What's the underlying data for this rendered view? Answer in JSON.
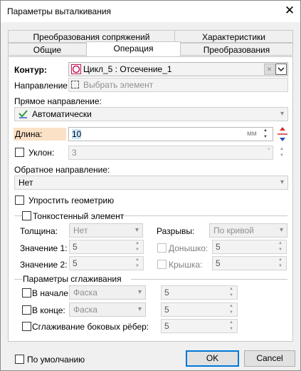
{
  "window": {
    "title": "Параметры выталкивания",
    "close_glyph": "✕"
  },
  "tabs": {
    "row1": [
      "Преобразования сопряжений",
      "Характеристики"
    ],
    "row2": [
      "Общие",
      "Операция",
      "Преобразования"
    ],
    "active": "Операция"
  },
  "contour": {
    "label": "Контур:",
    "value": "Цикл_5 : Отсечение_1"
  },
  "direction": {
    "label": "Направление:",
    "placeholder": "Выбрать элемент"
  },
  "forward": {
    "label": "Прямое направление:",
    "mode": "Автоматически"
  },
  "length": {
    "label": "Длина:",
    "value": "10",
    "unit": "мм"
  },
  "slope": {
    "label": "Уклон:",
    "value": "3",
    "unit": "°"
  },
  "reverse": {
    "label": "Обратное направление:",
    "mode": "Нет"
  },
  "simplify": {
    "label": "Упростить геометрию"
  },
  "thin_wall": {
    "label": "Тонкостенный элемент",
    "thickness_label": "Толщина:",
    "thickness_value": "Нет",
    "breaks_label": "Разрывы:",
    "breaks_value": "По кривой",
    "value1_label": "Значение 1:",
    "value1": "5",
    "value2_label": "Значение 2:",
    "value2": "5",
    "bottom_label": "Донышко:",
    "bottom_value": "5",
    "cover_label": "Крышка:",
    "cover_value": "5"
  },
  "smoothing": {
    "label": "Параметры сглаживания",
    "start_label": "В начале:",
    "start_type": "Фаска",
    "start_value": "5",
    "end_label": "В конце:",
    "end_type": "Фаска",
    "end_value": "5",
    "side_label": "Сглаживание боковых рёбер:",
    "side_value": "5"
  },
  "footer": {
    "default_label": "По умолчанию",
    "ok": "OK",
    "cancel": "Cancel"
  },
  "colors": {
    "accent": "#0078d7",
    "length_bg": "#fbe1c6",
    "value_highlight": "#cce8ff"
  }
}
